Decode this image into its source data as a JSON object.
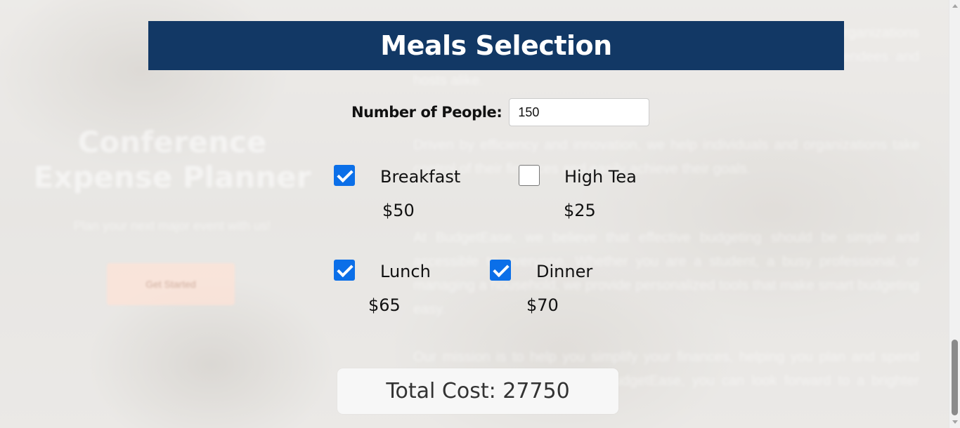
{
  "background": {
    "title": "Conference Expense Planner",
    "subtitle": "Plan your next major event with us!",
    "button_label": "Get Started",
    "paragraphs": [
      "comprehensive event planning and expense tracking solutions for organizations of all sizes and budgets, delivering seamless experiences for attendees and hosts alike.",
      "Driven by efficiency and innovation, we help individuals and organizations take control of their finances and easily achieve their goals.",
      "At BudgetEase, we believe that effective budgeting should be simple and accessible to everyone. Whether you are a student, a busy professional, or managing a household, we provide personalized tools that make smart budgeting easy.",
      "Our mission is to help you simplify your finances, helping you plan and spend wisely with confidence. With BudgetEase, you can look forward to a brighter financial future."
    ]
  },
  "header": {
    "title": "Meals Selection"
  },
  "people": {
    "label": "Number of People:",
    "value": "150"
  },
  "meals": [
    {
      "name": "Breakfast",
      "price": "$50",
      "checked": true
    },
    {
      "name": "High Tea",
      "price": "$25",
      "checked": false
    },
    {
      "name": "Lunch",
      "price": "$65",
      "checked": true
    },
    {
      "name": "Dinner",
      "price": "$70",
      "checked": true
    }
  ],
  "total": {
    "label": "Total Cost: 27750"
  },
  "colors": {
    "header_bg": "#123865",
    "checkbox_checked": "#0b6fe8",
    "total_bg": "#f7f7f7"
  }
}
